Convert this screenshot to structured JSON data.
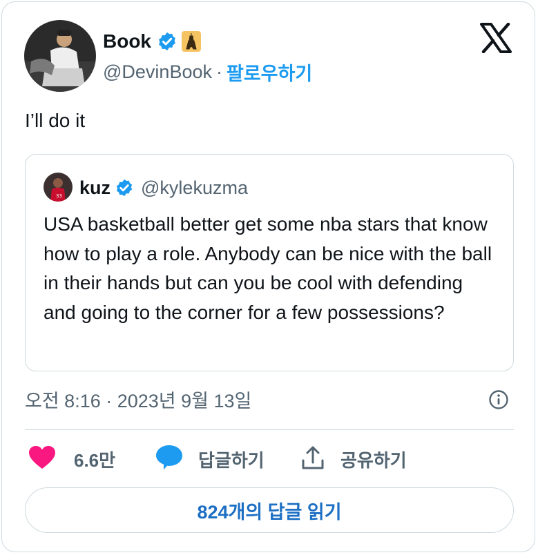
{
  "author": {
    "name": "Book",
    "handle": "@DevinBook",
    "separator": "·",
    "follow_label": "팔로우하기",
    "avatar_icon": "avatar-person-sitting",
    "affiliate_icon": "eiffel-tower-icon"
  },
  "tweet": {
    "text": "I’ll do it",
    "timestamp": "오전 8:16 · 2023년 9월 13일"
  },
  "quote": {
    "name": "kuz",
    "handle": "@kylekuzma",
    "text": "USA basketball better get some nba stars that know how to play a role. Anybody can be nice with the ball in their hands but can you be cool with defending and going to the corner for a few possessions?"
  },
  "actions": {
    "like_count": "6.6만",
    "reply_label": "답글하기",
    "share_label": "공유하기"
  },
  "read_replies_label": "824개의 답글 읽기",
  "colors": {
    "accent": "#1d9bf0",
    "heart": "#f91880",
    "secondary_text": "#536471",
    "border": "#cfd9de"
  }
}
